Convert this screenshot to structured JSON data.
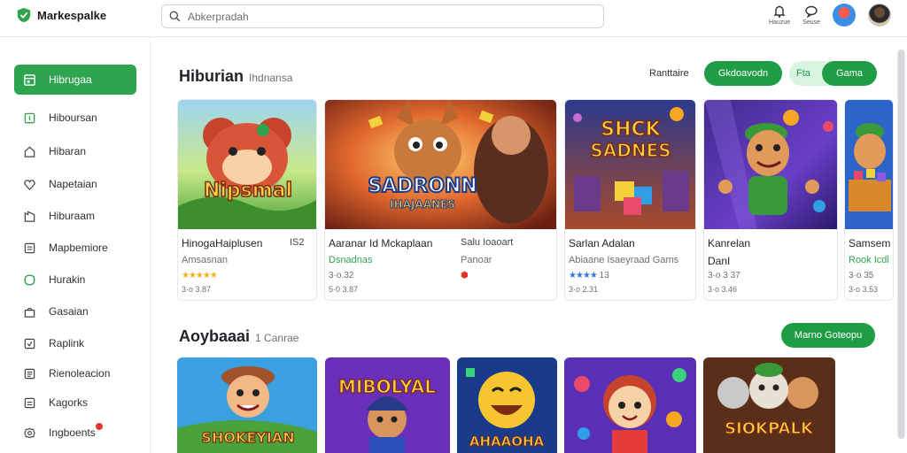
{
  "brand": {
    "name": "Markespalke"
  },
  "search": {
    "placeholder": "Abkerpradah"
  },
  "top_actions": [
    {
      "label": "Hauzue"
    },
    {
      "label": "Seuse"
    }
  ],
  "sidebar": {
    "items": [
      {
        "label": "Hibrugaa",
        "icon": "app-icon",
        "active": true
      },
      {
        "label": "Hiboursan",
        "icon": "square-icon"
      },
      {
        "label": "Hibaran",
        "icon": "home-icon"
      },
      {
        "label": "Napetaian",
        "icon": "tag-icon"
      },
      {
        "label": "Hiburaam",
        "icon": "building-icon"
      },
      {
        "label": "Mapbemiore",
        "icon": "list-icon"
      },
      {
        "label": "Hurakin",
        "icon": "circle-icon"
      },
      {
        "label": "Gasaian",
        "icon": "bag-icon"
      },
      {
        "label": "Raplink",
        "icon": "check-icon"
      },
      {
        "label": "Rienoleacion",
        "icon": "doc-icon"
      },
      {
        "label": "Kagorks",
        "icon": "list-icon"
      },
      {
        "label": "Ingboents",
        "icon": "gear-icon",
        "badge": true
      }
    ]
  },
  "section1": {
    "title": "Hiburian",
    "subtitle": "Ihdnansa",
    "sort_label": "Ranttaire",
    "primary_button": "Gkdoavodn",
    "pale_button": "Fta",
    "secondary_button": "Gama"
  },
  "cards": [
    {
      "title": "HinogaHaiplusen",
      "title_extra": "IS2",
      "line2": "Amsasnan",
      "line2_green": false,
      "stars": "★★★★★",
      "star_color": "gold",
      "line4": "3·o 3.87"
    },
    {
      "title": "Aaranar Id Mckaplaan",
      "title_extra": "Salu Ioaoart",
      "line2": "Dsnadnas",
      "line2_green": true,
      "line2b": "Panoar",
      "line3": "3·o.32",
      "line4": "5·0 3.87"
    },
    {
      "title": "Sarlan Adalan",
      "line2": "Abiaane  Isaeyraad Gams",
      "line2_green": false,
      "stars": "★★★★",
      "star_color": "blue",
      "line3b": "13",
      "line4": "3·o 2.31"
    },
    {
      "title": "Kanrelan",
      "title_line2": "DanI",
      "line2": "",
      "line3": "3·o 3 37",
      "line4": "3·o 3.46"
    },
    {
      "title": "Samsem",
      "line2": "Rook Icdl",
      "line2_green": true,
      "line3": "3·o 35",
      "line4": "3·o 3.53"
    }
  ],
  "section2": {
    "title": "Aoybaaai",
    "subtitle": "1 Canrae",
    "button": "Marno Goteopu"
  },
  "colors": {
    "accent": "#1f9d45",
    "accent_pale": "#d9f5e1"
  }
}
